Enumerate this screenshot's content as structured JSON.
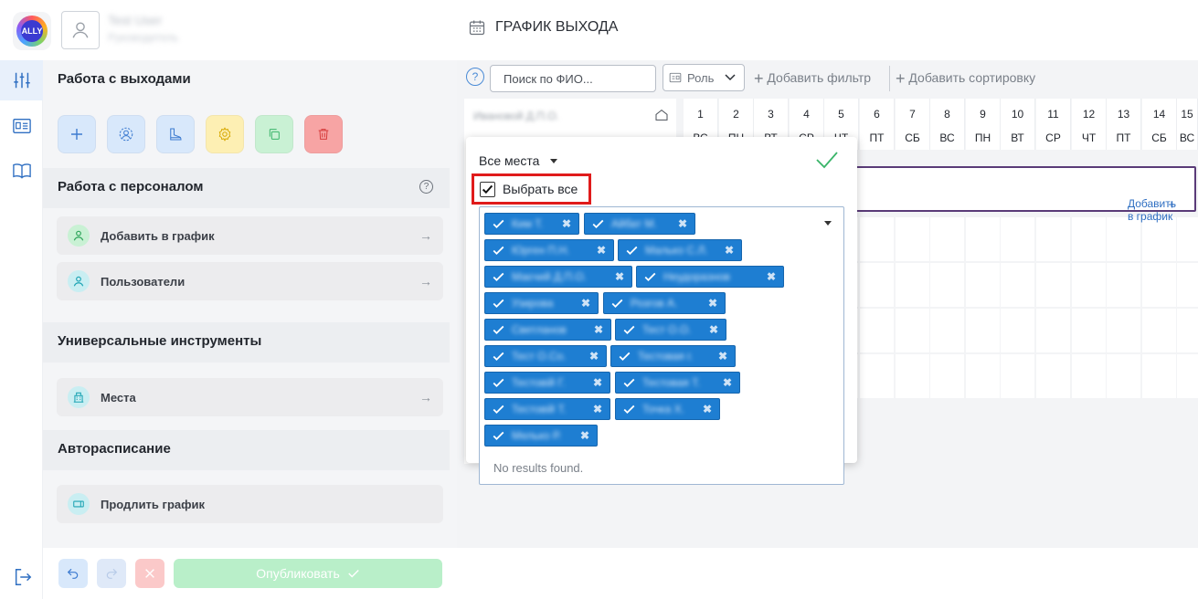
{
  "header": {
    "logo_text": "ALLY",
    "user_name": "Test User",
    "user_role": "Руководитель",
    "page_title": "ГРАФИК ВЫХОДА"
  },
  "panel": {
    "section1": "Работа с выходами",
    "section2": "Работа с персоналом",
    "section2_help": "?",
    "menu_add": "Добавить в график",
    "menu_users": "Пользователи",
    "section3": "Универсальные инструменты",
    "menu_places": "Места",
    "section4": "Авторасписание",
    "menu_extend": "Продлить график"
  },
  "toolbar": {
    "add": "+",
    "publish_label": "Опубликовать"
  },
  "filterbar": {
    "help": "?",
    "search_placeholder": "Поиск по ФИО...",
    "role_label": "Роль",
    "add_filter": "Добавить фильтр",
    "add_sort": "Добавить сортировку"
  },
  "calendar": {
    "name_header": "Ивановой Д.П.О.",
    "add_to_schedule": "Добавить в график",
    "days": [
      {
        "n": "1",
        "w": "ВС"
      },
      {
        "n": "2",
        "w": "ПН"
      },
      {
        "n": "3",
        "w": "ВТ"
      },
      {
        "n": "4",
        "w": "СР"
      },
      {
        "n": "5",
        "w": "ЧТ"
      },
      {
        "n": "6",
        "w": "ПТ"
      },
      {
        "n": "7",
        "w": "СБ"
      },
      {
        "n": "8",
        "w": "ВС"
      },
      {
        "n": "9",
        "w": "ПН"
      },
      {
        "n": "10",
        "w": "ВТ"
      },
      {
        "n": "11",
        "w": "СР"
      },
      {
        "n": "12",
        "w": "ЧТ"
      },
      {
        "n": "13",
        "w": "ПТ"
      },
      {
        "n": "14",
        "w": "СБ"
      },
      {
        "n": "15",
        "w": "ВС"
      }
    ]
  },
  "dropdown": {
    "title": "Все места",
    "select_all": "Выбрать все",
    "no_results": "No results found.",
    "chips": [
      "Ким Т.",
      "Айбат М.",
      "Юрген П.Н.",
      "Малько С.Л.",
      "Маєчий Д.П.О.",
      "Неудоразнов",
      "Узирова",
      "Розгов А.",
      "Светланов",
      "Тест О.О.",
      "Тест О.Со.",
      "Тестовая г.",
      "Тестовій Г.",
      "Тестовая Т.",
      "Тестовій Т.",
      "Точка Х.",
      "Мелько Р."
    ]
  },
  "colors": {
    "accent": "#1e7ed2",
    "highlight": "#e01b1b",
    "publish_bg": "#b9efc9"
  }
}
